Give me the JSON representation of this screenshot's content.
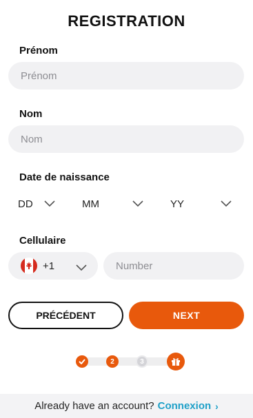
{
  "page": {
    "title": "REGISTRATION"
  },
  "form": {
    "first_name": {
      "label": "Prénom",
      "placeholder": "Prénom"
    },
    "last_name": {
      "label": "Nom",
      "placeholder": "Nom"
    },
    "dob": {
      "label": "Date de naissance",
      "day": "DD",
      "month": "MM",
      "year": "YY"
    },
    "phone": {
      "label": "Cellulaire",
      "country_code": "+1",
      "country_flag": "canada-flag-icon",
      "placeholder": "Number"
    }
  },
  "actions": {
    "previous_label": "PRÉCÉDENT",
    "next_label": "NEXT"
  },
  "stepper": {
    "steps": [
      {
        "state": "completed",
        "label": ""
      },
      {
        "state": "current",
        "label": "2"
      },
      {
        "state": "upcoming",
        "label": "3"
      },
      {
        "state": "reward",
        "icon": "gift-icon"
      }
    ]
  },
  "footer": {
    "prompt": "Already have an account?",
    "link_label": "Connexion",
    "link_chevron": "›"
  },
  "colors": {
    "accent": "#e8590c",
    "link": "#1ea0c8",
    "field_bg": "#f1f1f3"
  }
}
